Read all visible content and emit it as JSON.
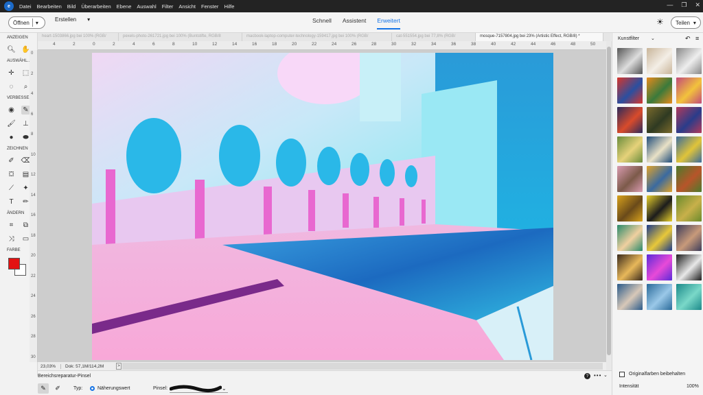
{
  "menubar": {
    "logo": "e",
    "items": [
      "Datei",
      "Bearbeiten",
      "Bild",
      "Überarbeiten",
      "Ebene",
      "Auswahl",
      "Filter",
      "Ansicht",
      "Fenster",
      "Hilfe"
    ],
    "window_controls": [
      "—",
      "❐",
      "✕"
    ]
  },
  "toolbar": {
    "open_label": "Öffnen",
    "create_label": "Erstellen",
    "modes": [
      "Schnell",
      "Assistent",
      "Erweitert"
    ],
    "active_mode": "Erweitert",
    "share_label": "Teilen"
  },
  "tabs": [
    "heart-1503866.jpg bei 100% (RGB/",
    "pexels-photo-261721.jpg bei 100% (Buntstifte, RGB/8",
    "macbook-laptop-computer-technology-159417.jpg bei 100% (RGB/",
    "cat-551554.jpg bei 77,8% (RGB/",
    "mosque-7157804.jpg bei 23% (Artistic Effect, RGB/8) *"
  ],
  "tools": {
    "sections": {
      "view": "ANZEIGEN",
      "select": "AUSWÄHL...",
      "enhance": "VERBESSE...",
      "draw": "ZEICHNEN",
      "modify": "ÄNDERN",
      "color": "FARBE"
    },
    "colors": {
      "foreground": "#e31212",
      "background": "#ffffff"
    }
  },
  "ruler": {
    "top": [
      "4",
      "2",
      "0",
      "2",
      "4",
      "6",
      "8",
      "10",
      "12",
      "14",
      "16",
      "18",
      "20",
      "22",
      "24",
      "26",
      "28",
      "30",
      "32",
      "34",
      "36",
      "38",
      "40",
      "42",
      "44",
      "46",
      "48",
      "50"
    ],
    "left": [
      "0",
      "2",
      "4",
      "6",
      "8",
      "10",
      "12",
      "14",
      "16",
      "18",
      "20",
      "22",
      "24",
      "26",
      "28",
      "30"
    ]
  },
  "status": {
    "zoom": "23,03%",
    "doc": "Dok: 57,1M/114,2M",
    "arrow": ">"
  },
  "options": {
    "tool_name": "Bereichsreparatur-Pinsel",
    "type_label": "Typ:",
    "type_value": "Näherungswert",
    "brush_label": "Pinsel:",
    "help": "?",
    "more": "•••",
    "collapse": "⌄"
  },
  "panel": {
    "title": "Kunstfilter",
    "keep_colors_label": "Originalfarben beibehalten",
    "intensity_label": "Intensität",
    "intensity_value": "100%",
    "filters": [
      {
        "name": "portrait-sketch",
        "c1": "#555",
        "c2": "#ddd"
      },
      {
        "name": "taj-sketch",
        "c1": "#c9b59a",
        "c2": "#f3eee6"
      },
      {
        "name": "city-sketch",
        "c1": "#888",
        "c2": "#eee"
      },
      {
        "name": "abstract-red",
        "c1": "#d7352a",
        "c2": "#2a4fa0"
      },
      {
        "name": "abstract-orange",
        "c1": "#e78a1c",
        "c2": "#3a7a3b"
      },
      {
        "name": "face-cubist",
        "c1": "#c24a7a",
        "c2": "#f2c23c"
      },
      {
        "name": "abstract-dark",
        "c1": "#2c2a5c",
        "c2": "#d94b2b"
      },
      {
        "name": "mona-lisa",
        "c1": "#7a6a2c",
        "c2": "#2f3a22"
      },
      {
        "name": "portrait-blue",
        "c1": "#b23a5a",
        "c2": "#2a3c8a"
      },
      {
        "name": "village",
        "c1": "#6a8c3c",
        "c2": "#e6d27a"
      },
      {
        "name": "great-wave",
        "c1": "#1f4c7a",
        "c2": "#e9e1c6"
      },
      {
        "name": "abstract-green",
        "c1": "#3a6b9c",
        "c2": "#e0c43a"
      },
      {
        "name": "dog-pink",
        "c1": "#d99bb0",
        "c2": "#7c5a4a"
      },
      {
        "name": "van-gogh",
        "c1": "#e0a32a",
        "c2": "#3a6aa0"
      },
      {
        "name": "landscape",
        "c1": "#4c7a2c",
        "c2": "#b7552a"
      },
      {
        "name": "yellow-field",
        "c1": "#d8a21c",
        "c2": "#6a4a1a"
      },
      {
        "name": "mondrian",
        "c1": "#e8d02c",
        "c2": "#1c1c1c"
      },
      {
        "name": "green-abstract",
        "c1": "#6a8a2c",
        "c2": "#c8b04a"
      },
      {
        "name": "woman-green",
        "c1": "#2a8a6a",
        "c2": "#f0d0a0"
      },
      {
        "name": "starry-night",
        "c1": "#1c3a8a",
        "c2": "#e8c83a"
      },
      {
        "name": "faces",
        "c1": "#3c3c5a",
        "c2": "#c89a7a"
      },
      {
        "name": "cafe",
        "c1": "#3a2a1c",
        "c2": "#e8b85a"
      },
      {
        "name": "neon-abstract",
        "c1": "#5a2ad8",
        "c2": "#e84ad8"
      },
      {
        "name": "splatter",
        "c1": "#1c1c1c",
        "c2": "#e8e8e8"
      },
      {
        "name": "dancers",
        "c1": "#2a5a8a",
        "c2": "#d8c8b8"
      },
      {
        "name": "forest-blue",
        "c1": "#2a6a9a",
        "c2": "#9ac8e8"
      },
      {
        "name": "teal-swirl",
        "c1": "#1c8a8a",
        "c2": "#7ad8c8"
      }
    ]
  }
}
